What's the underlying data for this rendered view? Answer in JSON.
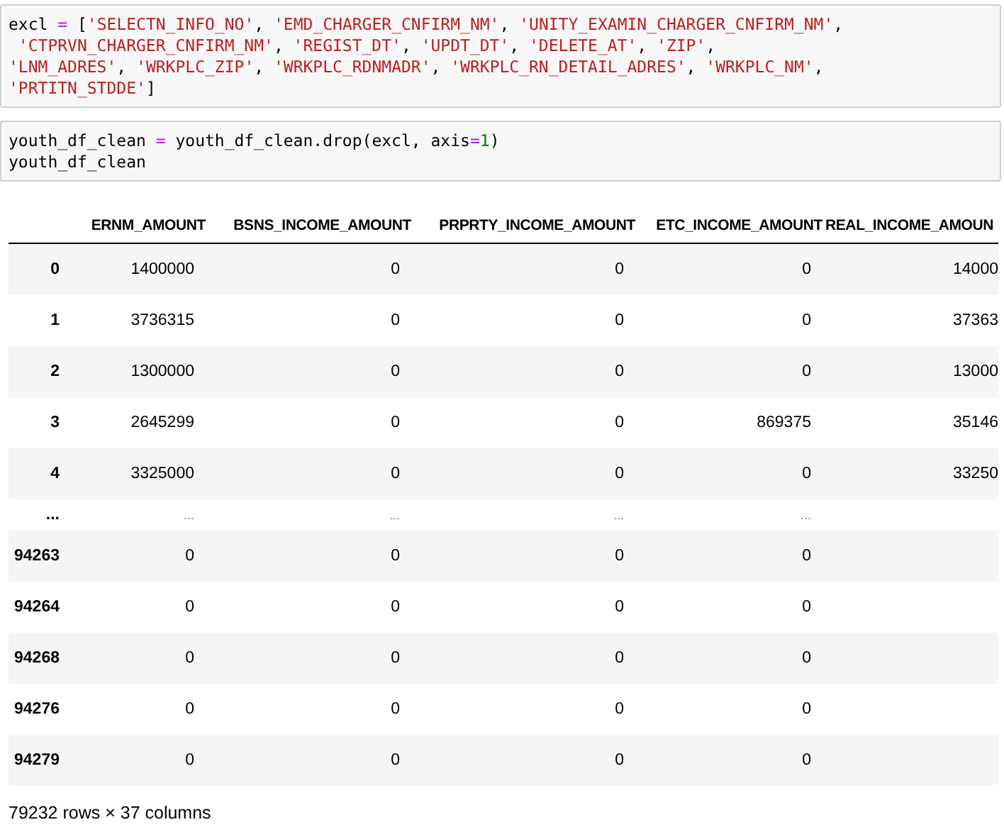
{
  "code_cells": [
    {
      "lines": [
        [
          {
            "kind": "name",
            "text": "excl "
          },
          {
            "kind": "op",
            "text": "="
          },
          {
            "kind": "punct",
            "text": " ["
          },
          {
            "kind": "str",
            "text": "'SELECTN_INFO_NO'"
          },
          {
            "kind": "punct",
            "text": ", "
          },
          {
            "kind": "str",
            "text": "'EMD_CHARGER_CNFIRM_NM'"
          },
          {
            "kind": "punct",
            "text": ", "
          },
          {
            "kind": "str",
            "text": "'UNITY_EXAMIN_CHARGER_CNFIRM_NM'"
          },
          {
            "kind": "punct",
            "text": ","
          }
        ],
        [
          {
            "kind": "str",
            "text": " 'CTPRVN_CHARGER_CNFIRM_NM'"
          },
          {
            "kind": "punct",
            "text": ", "
          },
          {
            "kind": "str",
            "text": "'REGIST_DT'"
          },
          {
            "kind": "punct",
            "text": ", "
          },
          {
            "kind": "str",
            "text": "'UPDT_DT'"
          },
          {
            "kind": "punct",
            "text": ", "
          },
          {
            "kind": "str",
            "text": "'DELETE_AT'"
          },
          {
            "kind": "punct",
            "text": ", "
          },
          {
            "kind": "str",
            "text": "'ZIP'"
          },
          {
            "kind": "punct",
            "text": ","
          }
        ],
        [
          {
            "kind": "str",
            "text": "'LNM_ADRES'"
          },
          {
            "kind": "punct",
            "text": ", "
          },
          {
            "kind": "str",
            "text": "'WRKPLC_ZIP'"
          },
          {
            "kind": "punct",
            "text": ", "
          },
          {
            "kind": "str",
            "text": "'WRKPLC_RDNMADR'"
          },
          {
            "kind": "punct",
            "text": ", "
          },
          {
            "kind": "str",
            "text": "'WRKPLC_RN_DETAIL_ADRES'"
          },
          {
            "kind": "punct",
            "text": ", "
          },
          {
            "kind": "str",
            "text": "'WRKPLC_NM'"
          },
          {
            "kind": "punct",
            "text": ","
          }
        ],
        [
          {
            "kind": "str",
            "text": "'PRTITN_STDDE'"
          },
          {
            "kind": "punct",
            "text": "]"
          }
        ]
      ]
    },
    {
      "lines": [
        [
          {
            "kind": "name",
            "text": "youth_df_clean "
          },
          {
            "kind": "op",
            "text": "="
          },
          {
            "kind": "name",
            "text": " youth_df_clean.drop(excl, axis"
          },
          {
            "kind": "op",
            "text": "="
          },
          {
            "kind": "num",
            "text": "1"
          },
          {
            "kind": "punct",
            "text": ")"
          }
        ],
        [
          {
            "kind": "name",
            "text": "youth_df_clean"
          }
        ]
      ]
    }
  ],
  "table": {
    "columns": [
      "ERNM_AMOUNT",
      "BSNS_INCOME_AMOUNT",
      "PRPRTY_INCOME_AMOUNT",
      "ETC_INCOME_AMOUNT",
      "REAL_INCOME_AMOUN"
    ],
    "rows": [
      {
        "kind": "data",
        "index": "0",
        "cells": [
          "1400000",
          "0",
          "0",
          "0",
          "14000"
        ]
      },
      {
        "kind": "data",
        "index": "1",
        "cells": [
          "3736315",
          "0",
          "0",
          "0",
          "37363"
        ]
      },
      {
        "kind": "data",
        "index": "2",
        "cells": [
          "1300000",
          "0",
          "0",
          "0",
          "13000"
        ]
      },
      {
        "kind": "data",
        "index": "3",
        "cells": [
          "2645299",
          "0",
          "0",
          "869375",
          "35146"
        ]
      },
      {
        "kind": "data",
        "index": "4",
        "cells": [
          "3325000",
          "0",
          "0",
          "0",
          "33250"
        ]
      },
      {
        "kind": "ellipsis",
        "index": "...",
        "cells": [
          "...",
          "...",
          "...",
          "..."
        ]
      },
      {
        "kind": "data",
        "index": "94263",
        "cells": [
          "0",
          "0",
          "0",
          "0"
        ]
      },
      {
        "kind": "data",
        "index": "94264",
        "cells": [
          "0",
          "0",
          "0",
          "0"
        ]
      },
      {
        "kind": "data",
        "index": "94268",
        "cells": [
          "0",
          "0",
          "0",
          "0"
        ]
      },
      {
        "kind": "data",
        "index": "94276",
        "cells": [
          "0",
          "0",
          "0",
          "0"
        ]
      },
      {
        "kind": "data",
        "index": "94279",
        "cells": [
          "0",
          "0",
          "0",
          "0"
        ]
      }
    ]
  },
  "footer": "79232 rows × 37 columns"
}
